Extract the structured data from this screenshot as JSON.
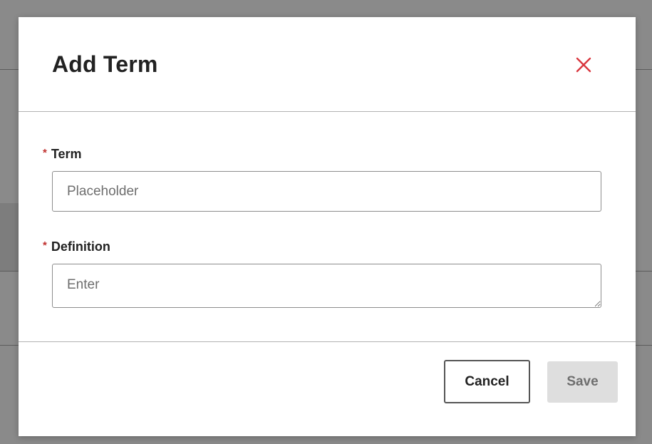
{
  "modal": {
    "title": "Add Term",
    "close_icon": "close-icon"
  },
  "form": {
    "term": {
      "required_marker": "*",
      "label": "Term",
      "placeholder": "Placeholder",
      "value": ""
    },
    "definition": {
      "required_marker": "*",
      "label": "Definition",
      "placeholder": "Enter",
      "value": ""
    }
  },
  "footer": {
    "cancel_label": "Cancel",
    "save_label": "Save"
  },
  "colors": {
    "close_icon": "#d9363e",
    "required_marker": "#c0302e",
    "save_disabled_bg": "#dedede"
  }
}
